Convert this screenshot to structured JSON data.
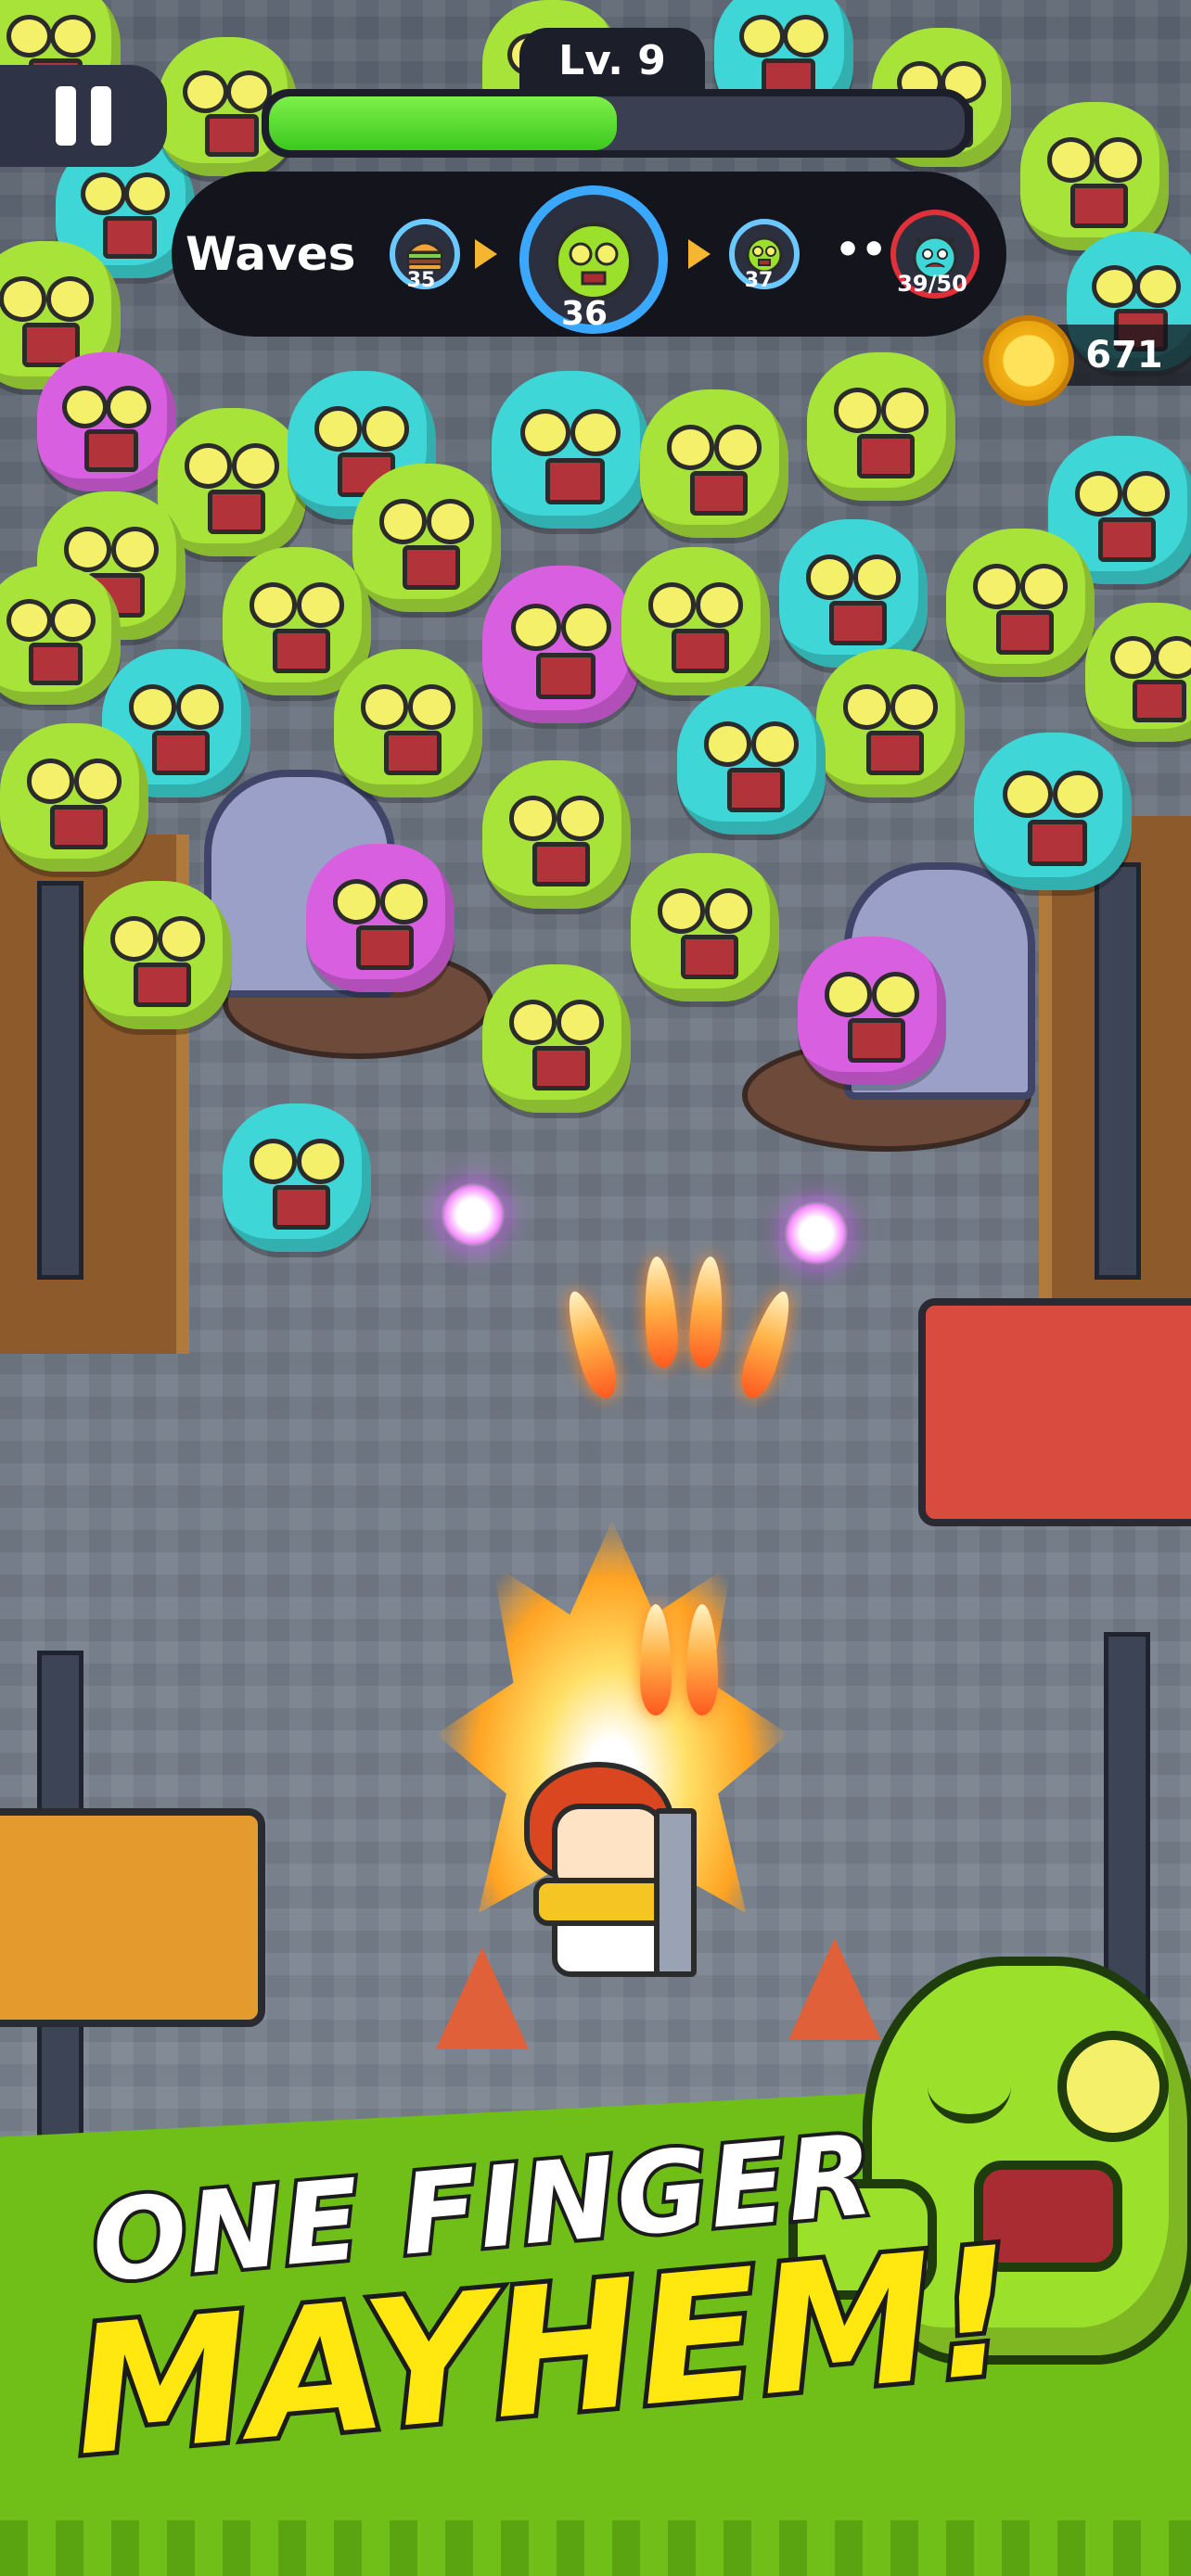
{
  "hud": {
    "level_label": "Lv. 9",
    "level_progress": 0.5,
    "coins": "671"
  },
  "waves": {
    "title": "Waves",
    "items": [
      {
        "number": "35",
        "icon": "burger-icon"
      },
      {
        "number": "36",
        "icon": "zombie-face-icon",
        "current": true
      },
      {
        "number": "37",
        "icon": "zombie-face-icon"
      },
      {
        "number": "39/50",
        "icon": "boss-zombie-icon"
      }
    ],
    "ellipsis": "•••"
  },
  "banner": {
    "line1": "ONE FINGER",
    "line2": "MAYHEM!"
  },
  "colors": {
    "accent_green": "#6fbf18",
    "headline_yellow": "#ffe70f",
    "xp_green": "#3cc81e",
    "wave_ring_blue": "#6cc9ff",
    "boss_ring_red": "#e0303a"
  }
}
